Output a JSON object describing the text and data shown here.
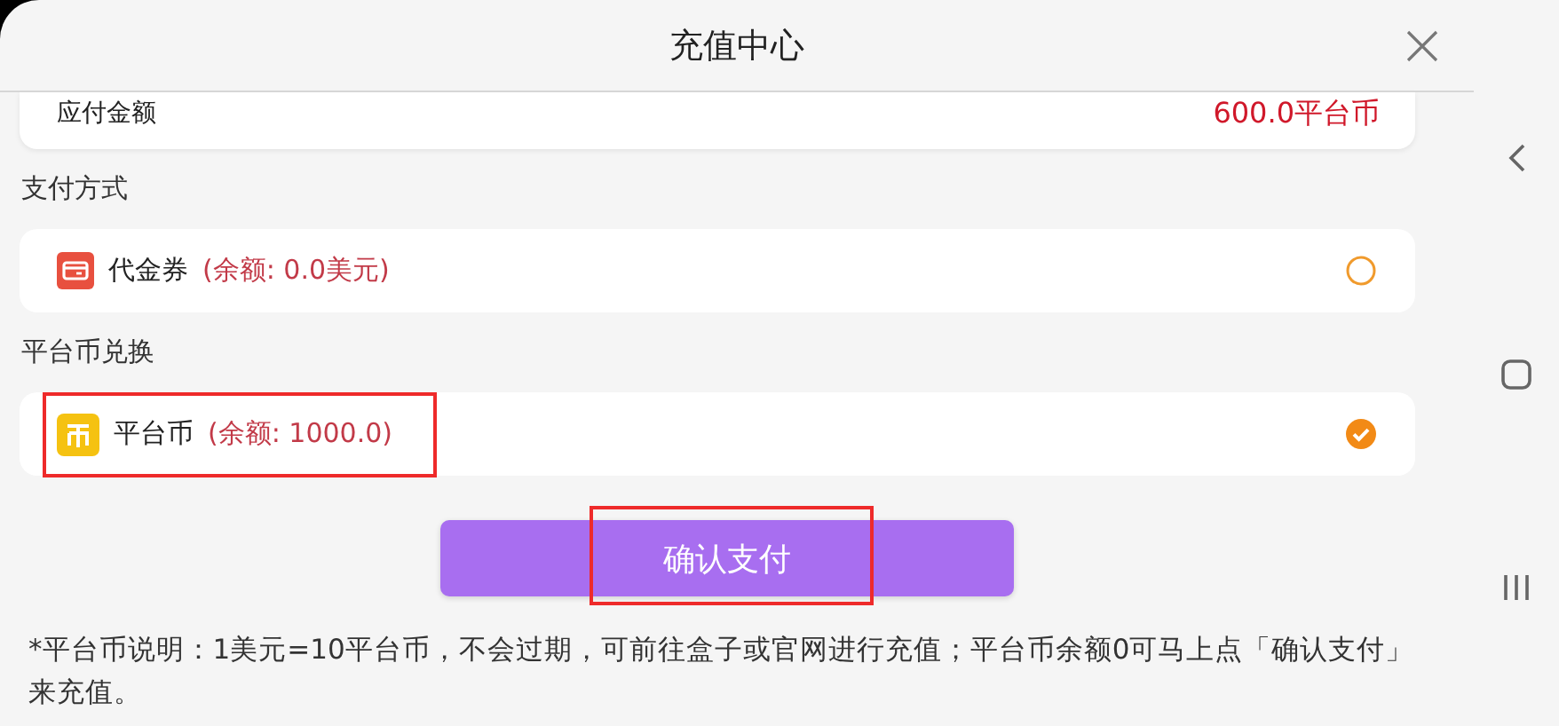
{
  "header": {
    "title": "充值中心"
  },
  "amount": {
    "label": "应付金额",
    "value": "600.0平台币"
  },
  "sections": [
    {
      "title": "支付方式",
      "options": [
        {
          "kind": "voucher",
          "name": "代金券",
          "balance": "(余额: 0.0美元)",
          "selected": false,
          "highlighted": false
        }
      ]
    },
    {
      "title": "平台币兑换",
      "options": [
        {
          "kind": "coin",
          "name": "平台币",
          "balance": "(余额: 1000.0)",
          "selected": true,
          "highlighted": true
        }
      ]
    }
  ],
  "confirm_button": {
    "label": "确认支付",
    "highlighted": true
  },
  "note": "*平台币说明：1美元=10平台币，不会过期，可前往盒子或官网进行充值；平台币余额0可马上点「确认支付」来充值。"
}
